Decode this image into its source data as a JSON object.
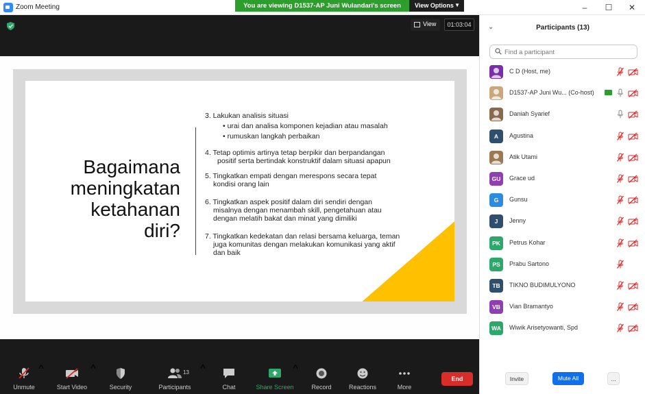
{
  "window": {
    "title": "Zoom Meeting",
    "banner_text": "You are viewing D1537-AP Juni Wulandari's screen",
    "view_options_label": "View Options"
  },
  "video": {
    "view_label": "View",
    "timer": "01:03:04"
  },
  "slide": {
    "title_lines": [
      "Bagaimana",
      "meningkatan",
      "ketahanan",
      "diri?"
    ],
    "point3_title": "3. Lakukan analisis situasi",
    "point3_bullet1": "• urai dan analisa komponen kejadian atau masalah",
    "point3_bullet2": "• rumuskan langkah perbaikan",
    "point4_line1": "4.  Tetap optimis artinya tetap berpikir dan berpandangan",
    "point4_line2": "positif serta bertindak konstruktif dalam situasi apapun",
    "point5_line1": "5. Tingkatkan empati dengan merespons secara tepat",
    "point5_line2": "kondisi orang lain",
    "point6_line1": "6. Tingkatkan aspek positif dalam diri sendiri dengan",
    "point6_line2": "misalnya dengan menambah skill, pengetahuan atau",
    "point6_line3": "dengan melatih bakat dan minat yang dimiliki",
    "point7_line1": "7. Tingkatkan kedekatan dan relasi bersama keluarga, teman",
    "point7_line2": "juga komunitas dengan melakukan komunikasi yang aktif",
    "point7_line3": "dan baik"
  },
  "toolbar": {
    "unmute": "Unmute",
    "start_video": "Start Video",
    "security": "Security",
    "participants": "Participants",
    "participants_count": "13",
    "chat": "Chat",
    "share_screen": "Share Screen",
    "record": "Record",
    "reactions": "Reactions",
    "more": "More",
    "end": "End"
  },
  "panel": {
    "title": "Participants (13)",
    "search_placeholder": "Find a participant",
    "participants": [
      {
        "name": "C D (Host, me)",
        "initials": "",
        "avatar_color": "#7a2fa8",
        "mic": "muted",
        "cam": "off",
        "cohost_badge": false
      },
      {
        "name": "D1537-AP Juni Wu...  (Co-host)",
        "initials": "",
        "avatar_color": "#c9a87c",
        "mic": "on",
        "cam": "off",
        "cohost_badge": true
      },
      {
        "name": "Daniah Syarief",
        "initials": "",
        "avatar_color": "#8a6a4e",
        "mic": "on",
        "cam": "off",
        "cohost_badge": false
      },
      {
        "name": "Agustina",
        "initials": "A",
        "avatar_color": "#2f4f6f",
        "mic": "muted",
        "cam": "off",
        "cohost_badge": false
      },
      {
        "name": "Atik Utami",
        "initials": "",
        "avatar_color": "#9b7a52",
        "mic": "muted",
        "cam": "off",
        "cohost_badge": false
      },
      {
        "name": "Grace ud",
        "initials": "GU",
        "avatar_color": "#8e3fb0",
        "mic": "muted",
        "cam": "off",
        "cohost_badge": false
      },
      {
        "name": "Gunsu",
        "initials": "G",
        "avatar_color": "#2d8ce0",
        "mic": "muted",
        "cam": "off",
        "cohost_badge": false
      },
      {
        "name": "Jenny",
        "initials": "J",
        "avatar_color": "#2f4f6f",
        "mic": "muted",
        "cam": "off",
        "cohost_badge": false
      },
      {
        "name": "Petrus Kohar",
        "initials": "PK",
        "avatar_color": "#2ea86a",
        "mic": "muted",
        "cam": "off",
        "cohost_badge": false
      },
      {
        "name": "Prabu Sartono",
        "initials": "PS",
        "avatar_color": "#2ea86a",
        "mic": "muted",
        "cam": "none",
        "cohost_badge": false
      },
      {
        "name": "TIKNO BUDIMULYONO",
        "initials": "TB",
        "avatar_color": "#2f4f6f",
        "mic": "muted",
        "cam": "off",
        "cohost_badge": false
      },
      {
        "name": "Vian Bramantyo",
        "initials": "VB",
        "avatar_color": "#8e3fb0",
        "mic": "muted",
        "cam": "off",
        "cohost_badge": false
      },
      {
        "name": "Wiwik Arisetyowanti, Spd",
        "initials": "WA",
        "avatar_color": "#2ea86a",
        "mic": "muted",
        "cam": "off",
        "cohost_badge": false
      }
    ],
    "invite": "Invite",
    "mute_all": "Mute All",
    "more": "..."
  },
  "colors": {
    "banner_green": "#2b9e2b",
    "slide_accent_yellow": "#ffc000",
    "end_red": "#d92d2a",
    "mute_all_blue": "#0e71eb",
    "muted_red": "#e02424"
  }
}
